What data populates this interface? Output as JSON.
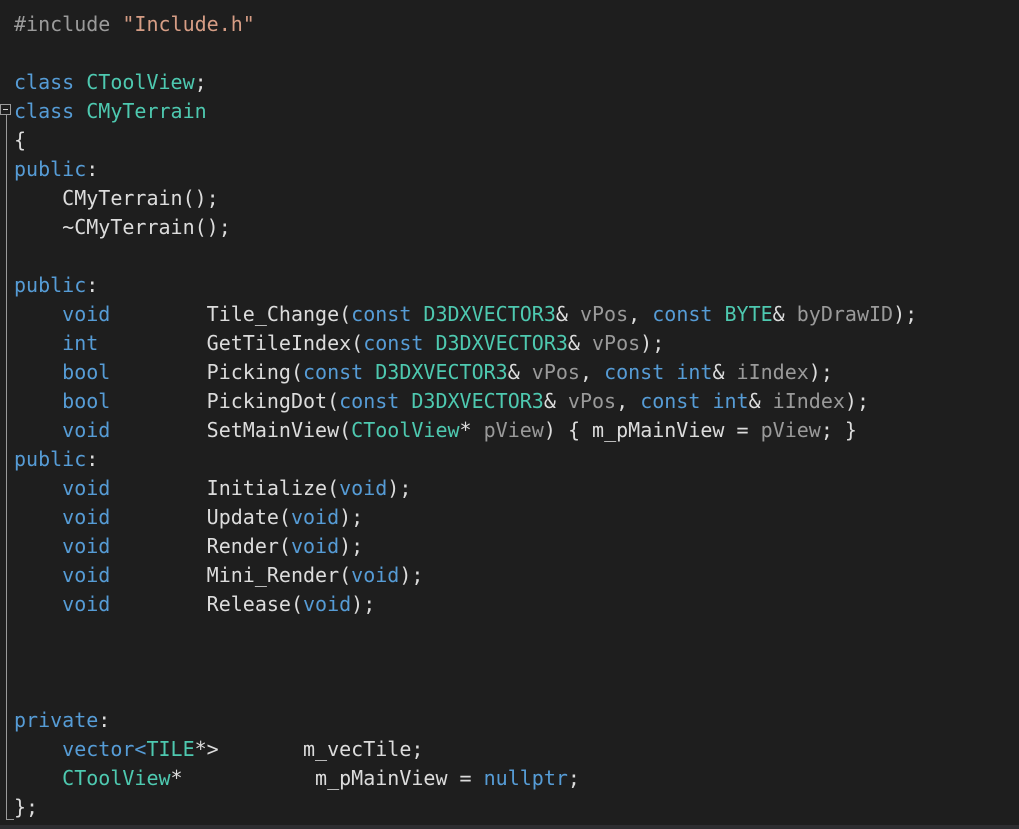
{
  "editor": {
    "lines": [
      [
        {
          "t": "#include ",
          "c": "pp"
        },
        {
          "t": "\"Include.h\"",
          "c": "str"
        }
      ],
      [],
      [
        {
          "t": "class ",
          "c": "kw"
        },
        {
          "t": "CToolView",
          "c": "ty"
        },
        {
          "t": ";",
          "c": "pl"
        }
      ],
      [
        {
          "t": "class ",
          "c": "kw"
        },
        {
          "t": "CMyTerrain",
          "c": "ty"
        }
      ],
      [
        {
          "t": "{",
          "c": "pl"
        }
      ],
      [
        {
          "t": "public",
          "c": "kw"
        },
        {
          "t": ":",
          "c": "pl"
        }
      ],
      [
        {
          "t": "    CMyTerrain();",
          "c": "fn"
        }
      ],
      [
        {
          "t": "    ~CMyTerrain();",
          "c": "fn"
        }
      ],
      [],
      [
        {
          "t": "public",
          "c": "kw"
        },
        {
          "t": ":",
          "c": "pl"
        }
      ],
      [
        {
          "t": "    ",
          "c": "pl"
        },
        {
          "t": "void",
          "c": "kw"
        },
        {
          "t": "        Tile_Change(",
          "c": "fn"
        },
        {
          "t": "const ",
          "c": "kw"
        },
        {
          "t": "D3DXVECTOR3",
          "c": "ty"
        },
        {
          "t": "& ",
          "c": "pl"
        },
        {
          "t": "vPos",
          "c": "pm"
        },
        {
          "t": ", ",
          "c": "pl"
        },
        {
          "t": "const ",
          "c": "kw"
        },
        {
          "t": "BYTE",
          "c": "ty"
        },
        {
          "t": "& ",
          "c": "pl"
        },
        {
          "t": "byDrawID",
          "c": "pm"
        },
        {
          "t": ");",
          "c": "pl"
        }
      ],
      [
        {
          "t": "    ",
          "c": "pl"
        },
        {
          "t": "int",
          "c": "kw"
        },
        {
          "t": "         GetTileIndex(",
          "c": "fn"
        },
        {
          "t": "const ",
          "c": "kw"
        },
        {
          "t": "D3DXVECTOR3",
          "c": "ty"
        },
        {
          "t": "& ",
          "c": "pl"
        },
        {
          "t": "vPos",
          "c": "pm"
        },
        {
          "t": ");",
          "c": "pl"
        }
      ],
      [
        {
          "t": "    ",
          "c": "pl"
        },
        {
          "t": "bool",
          "c": "kw"
        },
        {
          "t": "        Picking(",
          "c": "fn"
        },
        {
          "t": "const ",
          "c": "kw"
        },
        {
          "t": "D3DXVECTOR3",
          "c": "ty"
        },
        {
          "t": "& ",
          "c": "pl"
        },
        {
          "t": "vPos",
          "c": "pm"
        },
        {
          "t": ", ",
          "c": "pl"
        },
        {
          "t": "const ",
          "c": "kw"
        },
        {
          "t": "int",
          "c": "kw"
        },
        {
          "t": "& ",
          "c": "pl"
        },
        {
          "t": "iIndex",
          "c": "pm"
        },
        {
          "t": ");",
          "c": "pl"
        }
      ],
      [
        {
          "t": "    ",
          "c": "pl"
        },
        {
          "t": "bool",
          "c": "kw"
        },
        {
          "t": "        PickingDot(",
          "c": "fn"
        },
        {
          "t": "const ",
          "c": "kw"
        },
        {
          "t": "D3DXVECTOR3",
          "c": "ty"
        },
        {
          "t": "& ",
          "c": "pl"
        },
        {
          "t": "vPos",
          "c": "pm"
        },
        {
          "t": ", ",
          "c": "pl"
        },
        {
          "t": "const ",
          "c": "kw"
        },
        {
          "t": "int",
          "c": "kw"
        },
        {
          "t": "& ",
          "c": "pl"
        },
        {
          "t": "iIndex",
          "c": "pm"
        },
        {
          "t": ");",
          "c": "pl"
        }
      ],
      [
        {
          "t": "    ",
          "c": "pl"
        },
        {
          "t": "void",
          "c": "kw"
        },
        {
          "t": "        SetMainView(",
          "c": "fn"
        },
        {
          "t": "CToolView",
          "c": "ty"
        },
        {
          "t": "* ",
          "c": "pl"
        },
        {
          "t": "pView",
          "c": "pm"
        },
        {
          "t": ") { m_pMainView = ",
          "c": "pl"
        },
        {
          "t": "pView",
          "c": "pm"
        },
        {
          "t": "; }",
          "c": "pl"
        }
      ],
      [
        {
          "t": "public",
          "c": "kw"
        },
        {
          "t": ":",
          "c": "pl"
        }
      ],
      [
        {
          "t": "    ",
          "c": "pl"
        },
        {
          "t": "void",
          "c": "kw"
        },
        {
          "t": "        Initialize(",
          "c": "fn"
        },
        {
          "t": "void",
          "c": "kw"
        },
        {
          "t": ");",
          "c": "pl"
        }
      ],
      [
        {
          "t": "    ",
          "c": "pl"
        },
        {
          "t": "void",
          "c": "kw"
        },
        {
          "t": "        Update(",
          "c": "fn"
        },
        {
          "t": "void",
          "c": "kw"
        },
        {
          "t": ");",
          "c": "pl"
        }
      ],
      [
        {
          "t": "    ",
          "c": "pl"
        },
        {
          "t": "void",
          "c": "kw"
        },
        {
          "t": "        Render(",
          "c": "fn"
        },
        {
          "t": "void",
          "c": "kw"
        },
        {
          "t": ");",
          "c": "pl"
        }
      ],
      [
        {
          "t": "    ",
          "c": "pl"
        },
        {
          "t": "void",
          "c": "kw"
        },
        {
          "t": "        Mini_Render(",
          "c": "fn"
        },
        {
          "t": "void",
          "c": "kw"
        },
        {
          "t": ");",
          "c": "pl"
        }
      ],
      [
        {
          "t": "    ",
          "c": "pl"
        },
        {
          "t": "void",
          "c": "kw"
        },
        {
          "t": "        Release(",
          "c": "fn"
        },
        {
          "t": "void",
          "c": "kw"
        },
        {
          "t": ");",
          "c": "pl"
        }
      ],
      [],
      [],
      [],
      [
        {
          "t": "private",
          "c": "kw"
        },
        {
          "t": ":",
          "c": "pl"
        }
      ],
      [
        {
          "t": "    vector<",
          "c": "kw"
        },
        {
          "t": "TILE",
          "c": "ty"
        },
        {
          "t": "*>       m_vecTile;",
          "c": "pl"
        }
      ],
      [
        {
          "t": "    ",
          "c": "pl"
        },
        {
          "t": "CToolView",
          "c": "ty"
        },
        {
          "t": "*           m_pMainView = ",
          "c": "pl"
        },
        {
          "t": "nullptr",
          "c": "kw"
        },
        {
          "t": ";",
          "c": "pl"
        }
      ],
      [
        {
          "t": "};",
          "c": "pl"
        }
      ]
    ]
  },
  "colors": {
    "background": "#1e1e1e",
    "keyword": "#569cd6",
    "type": "#4ec9b0",
    "preprocessor": "#9b9b9b",
    "string": "#d69d85",
    "default": "#dcdcdc",
    "parameter": "#9a9a9a"
  },
  "icons": {
    "fold": "collapse-minus-icon"
  }
}
